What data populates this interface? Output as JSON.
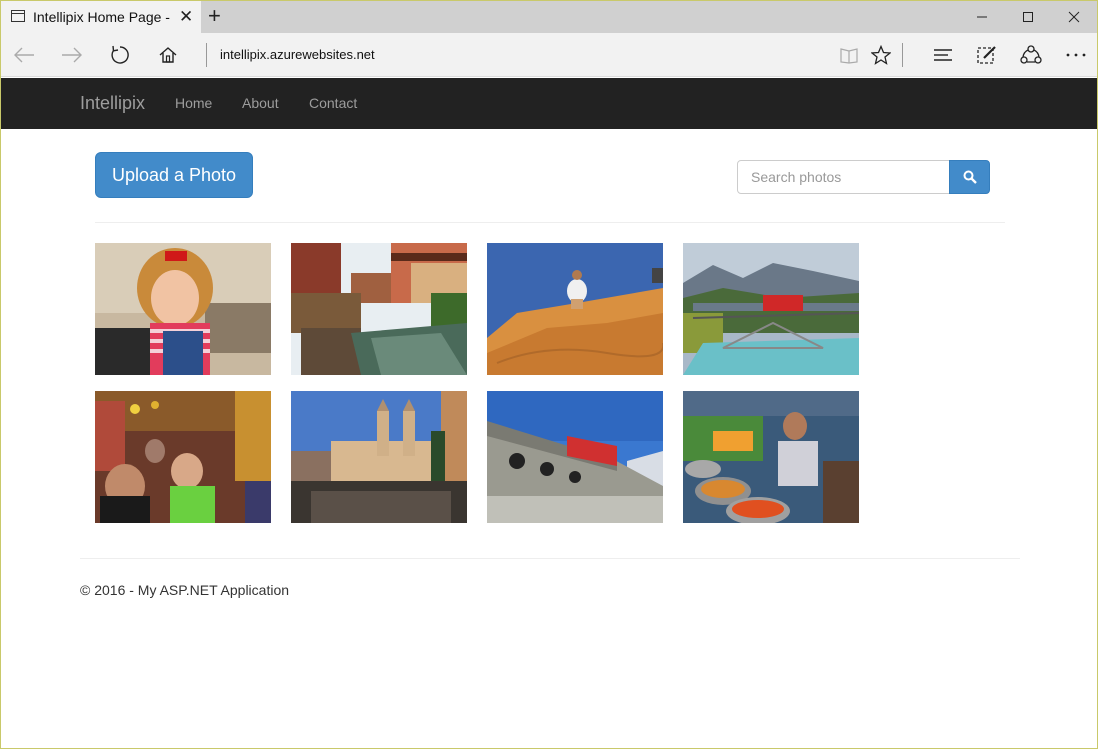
{
  "browser": {
    "tab_title": "Intellipix Home Page - M",
    "url": "intellipix.azurewebsites.net",
    "icons": [
      "page-icon",
      "close-icon",
      "new-tab-icon",
      "minimize-icon",
      "maximize-icon",
      "close-window-icon",
      "back-icon",
      "forward-icon",
      "refresh-icon",
      "home-icon",
      "reading-view-icon",
      "favorite-star-icon",
      "hub-icon",
      "web-note-icon",
      "share-icon",
      "more-icon"
    ]
  },
  "site": {
    "brand": "Intellipix",
    "nav": [
      "Home",
      "About",
      "Contact"
    ]
  },
  "main": {
    "upload_label": "Upload a Photo",
    "search_placeholder": "Search photos",
    "photos": [
      "girl-in-striped-shirt",
      "canal-village",
      "desert-dune",
      "mountain-train-bridge",
      "market-street",
      "spanish-steps-church",
      "red-train-viaduct",
      "street-food-stall"
    ]
  },
  "footer": {
    "text": "© 2016 - My ASP.NET Application"
  },
  "colors": {
    "navbar": "#222222",
    "primary": "#428bca",
    "nav_text": "#9d9d9d"
  }
}
